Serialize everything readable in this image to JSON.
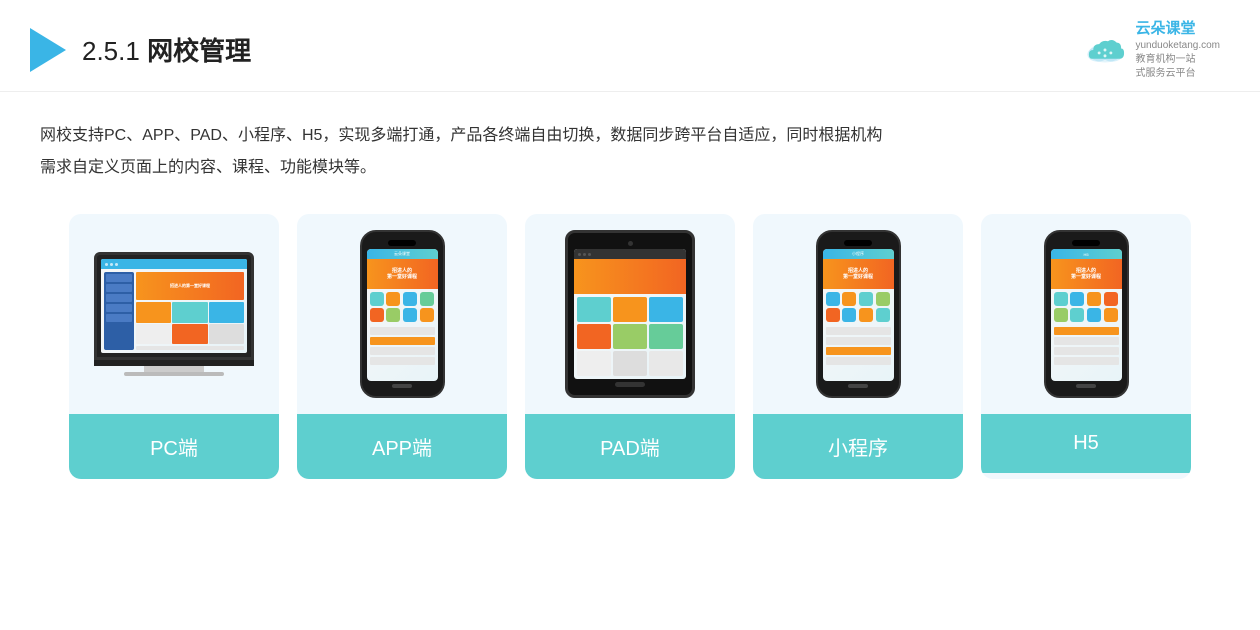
{
  "header": {
    "title_prefix": "2.5.1 ",
    "title_bold": "网校管理",
    "logo_brand": "云朵课堂",
    "logo_url": "yunduoketang.com",
    "logo_slogan1": "教育机构一站",
    "logo_slogan2": "式服务云平台"
  },
  "description": {
    "line1": "网校支持PC、APP、PAD、小程序、H5，实现多端打通，产品各终端自由切换，数据同步跨平台自适应，同时根据机构",
    "line2": "需求自定义页面上的内容、课程、功能模块等。"
  },
  "cards": [
    {
      "id": "pc",
      "label": "PC端"
    },
    {
      "id": "app",
      "label": "APP端"
    },
    {
      "id": "pad",
      "label": "PAD端"
    },
    {
      "id": "miniapp",
      "label": "小程序"
    },
    {
      "id": "h5",
      "label": "H5"
    }
  ],
  "colors": {
    "accent": "#3ab5e6",
    "teal": "#5ecfcf",
    "orange": "#f7941d",
    "bg_card": "#f0f8fd"
  }
}
